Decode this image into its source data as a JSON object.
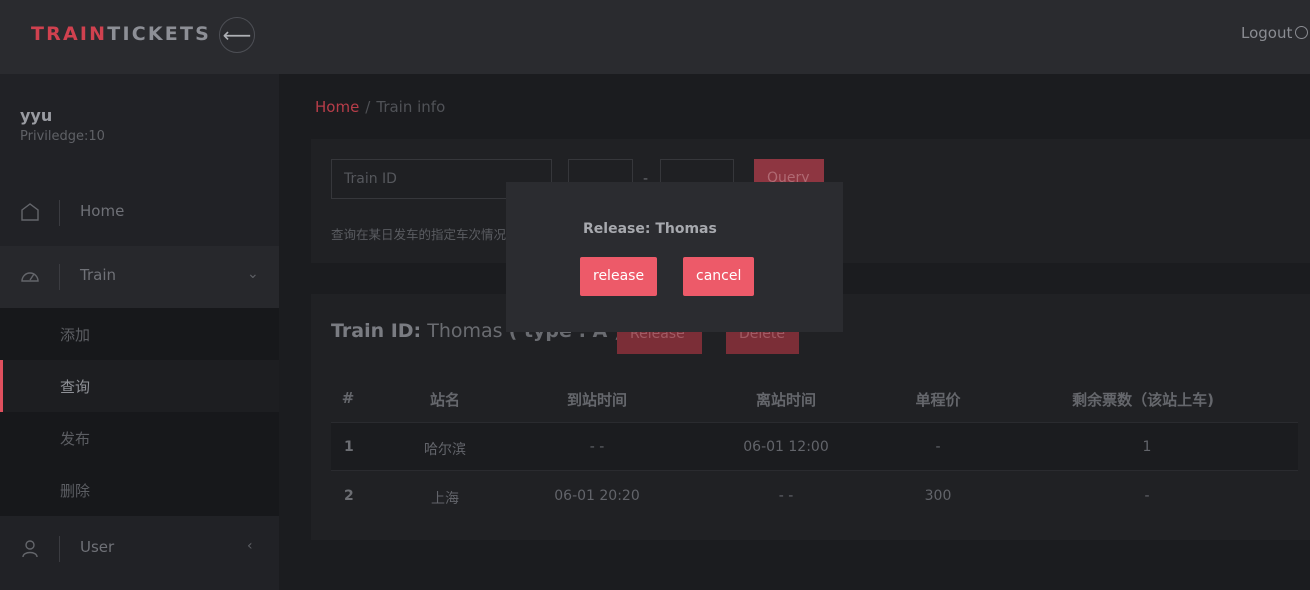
{
  "app": {
    "logo_part1": "TRAIN",
    "logo_part2": "TICKETS",
    "back_symbol": "⟵",
    "logout_label": "Logout"
  },
  "user": {
    "name": "yyu",
    "privilege": "Priviledge:10"
  },
  "sidebar": {
    "home": "Home",
    "train": "Train",
    "train_sub": [
      "添加",
      "查询",
      "发布",
      "删除"
    ],
    "user": "User"
  },
  "breadcrumb": {
    "home": "Home",
    "sep": "/",
    "current": "Train info"
  },
  "query": {
    "train_id_placeholder": "Train ID",
    "range_sep": "-",
    "query_label": "Query",
    "hint": "查询在某日发车的指定车次情况"
  },
  "train": {
    "id_label": "Train ID:",
    "id_value": "Thomas",
    "type_text": "( type : A )",
    "release_label": "Release",
    "delete_label": "Delete"
  },
  "table": {
    "headers": [
      "#",
      "站名",
      "到站时间",
      "离站时间",
      "单程价",
      "剩余票数（该站上车)"
    ],
    "rows": [
      [
        "1",
        "哈尔滨",
        "- -",
        "06-01 12:00",
        "-",
        "1"
      ],
      [
        "2",
        "上海",
        "06-01 20:20",
        "- -",
        "300",
        "-"
      ]
    ]
  },
  "modal": {
    "text": "Release: Thomas",
    "release_label": "release",
    "cancel_label": "cancel"
  },
  "colors": {
    "accent": "#ed5a69",
    "logo_red": "#d0414f",
    "background": "#1b1c1f"
  }
}
